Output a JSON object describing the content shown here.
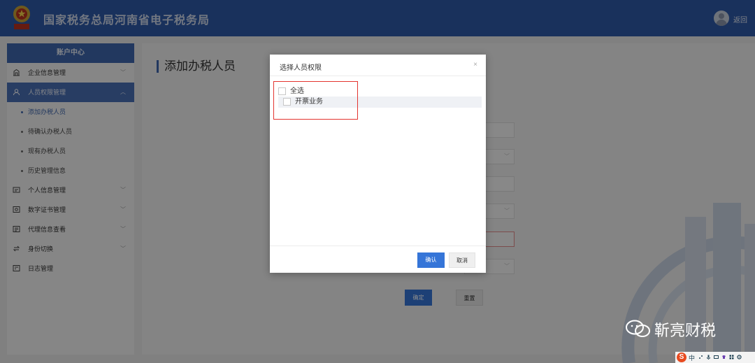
{
  "header": {
    "site_title": "国家税务总局河南省电子税务局",
    "back_label": "返回"
  },
  "sidebar": {
    "heading": "账户中心",
    "items": [
      {
        "label": "企业信息管理",
        "icon": "building-icon",
        "expanded": false
      },
      {
        "label": "人员权限管理",
        "icon": "people-icon",
        "expanded": true,
        "children": [
          {
            "label": "添加办税人员",
            "current": true
          },
          {
            "label": "待确认办税人员"
          },
          {
            "label": "现有办税人员"
          },
          {
            "label": "历史管理信息"
          }
        ]
      },
      {
        "label": "个人信息管理",
        "icon": "id-card-icon",
        "expanded": false
      },
      {
        "label": "数字证书管理",
        "icon": "certificate-icon",
        "expanded": false
      },
      {
        "label": "代理信息查看",
        "icon": "agent-icon",
        "expanded": false
      },
      {
        "label": "身份切换",
        "icon": "switch-icon",
        "expanded": false
      },
      {
        "label": "日志管理",
        "icon": "log-icon",
        "expanded": false
      }
    ]
  },
  "main": {
    "page_title": "添加办税人员",
    "confirm_label": "确定",
    "reset_label": "重置"
  },
  "modal": {
    "title": "选择人员权限",
    "close_glyph": "×",
    "tree": [
      {
        "label": "全选",
        "checked": false
      },
      {
        "label": "开票业务",
        "checked": false
      }
    ],
    "ok_label": "确认",
    "cancel_label": "取消"
  },
  "watermark": {
    "text": "靳亮财税"
  },
  "taskbar": {
    "ime_label": "中"
  },
  "colors": {
    "header": "#2f5aa8",
    "accent": "#3e66ad",
    "primary_button": "#3575d8",
    "highlight": "#e3342f"
  }
}
